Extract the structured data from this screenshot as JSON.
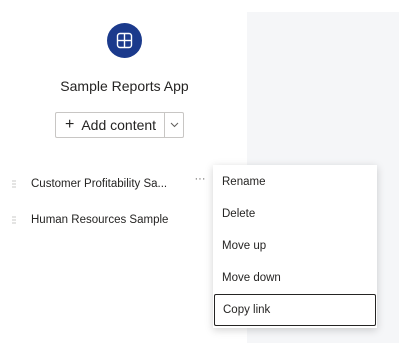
{
  "app": {
    "icon": "app-icon",
    "title": "Sample Reports App"
  },
  "toolbar": {
    "add_label": "Add content",
    "add_plus": "+"
  },
  "nav": {
    "items": [
      {
        "label": "Customer Profitability Sa...",
        "icon": "drag-handle-icon"
      },
      {
        "label": "Human Resources Sample",
        "icon": "drag-handle-icon"
      }
    ],
    "more_label": "···"
  },
  "context_menu": {
    "items": [
      {
        "label": "Rename"
      },
      {
        "label": "Delete"
      },
      {
        "label": "Move up"
      },
      {
        "label": "Move down"
      },
      {
        "label": "Copy link"
      }
    ]
  },
  "colors": {
    "app_icon_bg": "#1b3a8c",
    "text": "#252423",
    "panel_bg": "#f5f6f8"
  }
}
